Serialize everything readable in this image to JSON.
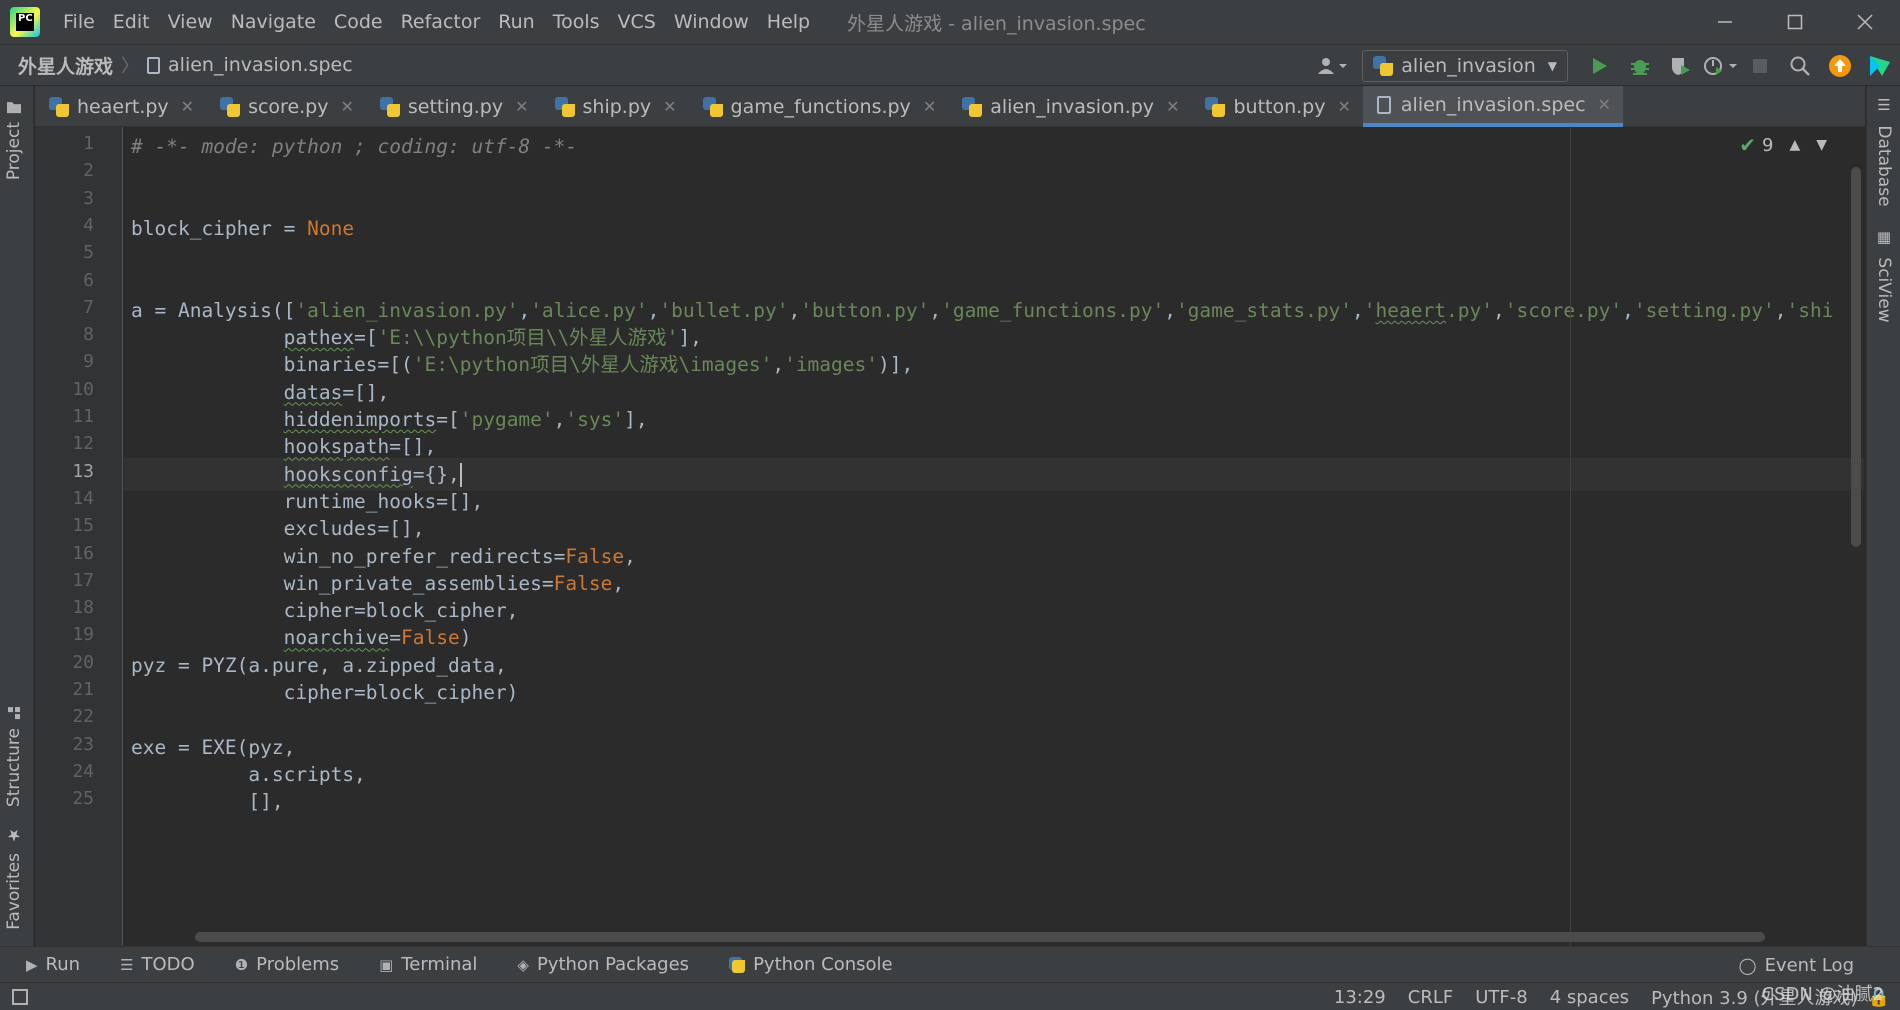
{
  "menu": [
    "File",
    "Edit",
    "View",
    "Navigate",
    "Code",
    "Refactor",
    "Run",
    "Tools",
    "VCS",
    "Window",
    "Help"
  ],
  "window_title": "外星人游戏 - alien_invasion.spec",
  "breadcrumb": {
    "project": "外星人游戏",
    "file": "alien_invasion.spec"
  },
  "run_config": "alien_invasion",
  "tabs": [
    {
      "label": "heaert.py",
      "type": "python"
    },
    {
      "label": "score.py",
      "type": "python"
    },
    {
      "label": "setting.py",
      "type": "python"
    },
    {
      "label": "ship.py",
      "type": "python"
    },
    {
      "label": "game_functions.py",
      "type": "python"
    },
    {
      "label": "alien_invasion.py",
      "type": "python"
    },
    {
      "label": "button.py",
      "type": "python"
    },
    {
      "label": "alien_invasion.spec",
      "type": "spec",
      "active": true
    }
  ],
  "side_tabs": {
    "left_top": "Project",
    "left_mid": "Structure",
    "left_bottom": "Favorites",
    "right_top": "Database",
    "right_mid": "SciView"
  },
  "editor": {
    "inspection_count": "9",
    "current_line": 13,
    "line_numbers": [
      "1",
      "2",
      "3",
      "4",
      "5",
      "6",
      "7",
      "8",
      "9",
      "10",
      "11",
      "12",
      "13",
      "14",
      "15",
      "16",
      "17",
      "18",
      "19",
      "20",
      "21",
      "22",
      "23",
      "24",
      "25"
    ],
    "lines": [
      "# -*- mode: python ; coding: utf-8 -*-",
      "",
      "",
      "block_cipher = None",
      "",
      "",
      "a = Analysis(['alien_invasion.py','alice.py','bullet.py','button.py','game_functions.py','game_stats.py','heaert.py','score.py','setting.py','shi",
      "             pathex=['E:\\\\python项目\\\\外星人游戏'],",
      "             binaries=[('E:\\python项目\\外星人游戏\\images','images')],",
      "             datas=[],",
      "             hiddenimports=['pygame','sys'],",
      "             hookspath=[],",
      "             hooksconfig={},",
      "             runtime_hooks=[],",
      "             excludes=[],",
      "             win_no_prefer_redirects=False,",
      "             win_private_assemblies=False,",
      "             cipher=block_cipher,",
      "             noarchive=False)",
      "pyz = PYZ(a.pure, a.zipped_data,",
      "             cipher=block_cipher)",
      "",
      "exe = EXE(pyz,",
      "          a.scripts,",
      "          [],"
    ]
  },
  "bottom_tools": [
    "Run",
    "TODO",
    "Problems",
    "Terminal",
    "Python Packages",
    "Python Console"
  ],
  "event_log": "Event Log",
  "status": {
    "position": "13:29",
    "line_sep": "CRLF",
    "encoding": "UTF-8",
    "indent": "4 spaces",
    "interpreter": "Python 3.9 (外星人游戏)"
  },
  "watermark": "CSDN @油腻2",
  "colors": {
    "bg": "#2b2b2b",
    "chrome": "#3c3f41",
    "accent": "#4a88c7",
    "keyword": "#cc7832",
    "string": "#6a8759",
    "param": "#aa4926"
  }
}
